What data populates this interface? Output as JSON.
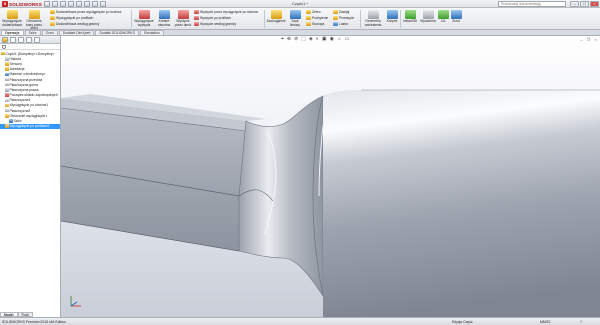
{
  "app": {
    "logo_text": "SOLIDWORKS",
    "window_title": "Część1 *",
    "search_placeholder": "Przeszukaj dokumentację"
  },
  "ribbon": {
    "large_left": [
      {
        "label": "Wyciągnięcie dodania/baza",
        "icon": "extrude-boss-icon",
        "color": "y"
      },
      {
        "label": "Obrócenie bazy przez obrót",
        "icon": "revolve-boss-icon",
        "color": "y"
      }
    ],
    "small_left": [
      "Dodanie/baza przez wyciągnięcie po ścieżce",
      "Wyciągnięcie po profilach",
      "Dodanie/baza według granicy"
    ],
    "large_cut": [
      {
        "label": "Wyciągnięcie wycięcia",
        "icon": "extrude-cut-icon",
        "color": "r"
      },
      {
        "label": "Kreator otworów",
        "icon": "hole-wizard-icon",
        "color": "b"
      },
      {
        "label": "Wycięcie przez obrót",
        "icon": "revolve-cut-icon",
        "color": "r"
      }
    ],
    "small_cut": [
      "Wycięcie przez wyciągnięcie po ścieżce",
      "Wycięcie po profilach",
      "Wycięcie według granicy"
    ],
    "features": [
      {
        "label": "Zaokrąglenie",
        "icon": "fillet-icon",
        "color": "y"
      },
      {
        "label": "Szyk liniowy",
        "icon": "linear-pattern-icon",
        "color": "b"
      }
    ],
    "features_small": [
      "Żebro",
      "Pochylenie",
      "Skorupa",
      "Zawijaj",
      "Przecięcie",
      "Lustro"
    ],
    "geometry": [
      {
        "label": "Geometria odniesienia",
        "icon": "reference-geometry-icon",
        "color": "gr"
      },
      {
        "label": "Krzywe",
        "icon": "curves-icon",
        "color": "b"
      },
      {
        "label": "Instant3D",
        "icon": "instant3d-icon",
        "color": "g"
      }
    ],
    "extras": [
      {
        "label": "Wyrażenia",
        "icon": "equations-icon",
        "color": "gr"
      },
      {
        "label": "CA",
        "icon": "ca-icon",
        "color": "g"
      },
      {
        "label": "Zrzut",
        "icon": "capture-icon",
        "color": "b"
      }
    ]
  },
  "cmd_tabs": [
    "Operacje",
    "Szkic",
    "Oceń",
    "Dodatek DimXpert",
    "Dodatki SOLIDWORKS",
    "Simulation"
  ],
  "tree": {
    "root": "Część1 (Domyślny<<Domyślny>",
    "items": [
      {
        "label": "Historia",
        "icon": "history-icon",
        "indent": 1,
        "color": "gr"
      },
      {
        "label": "Sensory",
        "icon": "sensor-icon",
        "indent": 1,
        "color": "y"
      },
      {
        "label": "Adnotacje",
        "icon": "annotation-icon",
        "indent": 1,
        "color": "y"
      },
      {
        "label": "Materiał <nieokreślony>",
        "icon": "material-icon",
        "indent": 1,
        "color": "b"
      },
      {
        "label": "Płaszczyzna przednia",
        "icon": "plane-icon",
        "indent": 1,
        "color": "gr"
      },
      {
        "label": "Płaszczyzna górna",
        "icon": "plane-icon",
        "indent": 1,
        "color": "gr"
      },
      {
        "label": "Płaszczyzna prawa",
        "icon": "plane-icon",
        "indent": 1,
        "color": "gr"
      },
      {
        "label": "Początek układu współrzędnych",
        "icon": "origin-icon",
        "indent": 1,
        "color": "r"
      },
      {
        "label": "Płaszczyzna1",
        "icon": "plane-icon",
        "indent": 1,
        "color": "gr"
      },
      {
        "label": "Wyciągnięcie po ścieżce1",
        "icon": "sweep-icon",
        "indent": 1,
        "color": "y"
      },
      {
        "label": "Płaszczyzna2",
        "icon": "plane-icon",
        "indent": 1,
        "color": "gr"
      },
      {
        "label": "Obrócenie wyciągnięcie1",
        "icon": "revolve-icon",
        "indent": 1,
        "color": "y"
      },
      {
        "label": "Szkic",
        "icon": "sketch-icon",
        "indent": 2,
        "color": "b"
      },
      {
        "label": "Wyciągnięcie po profilach1",
        "icon": "loft-icon",
        "indent": 1,
        "color": "y",
        "selected": true
      }
    ]
  },
  "model_tabs": [
    "Model",
    "Ruch"
  ],
  "status": {
    "left": "SOLIDWORKS Premium 2015 x64 Edition",
    "middle": "Edycja Część",
    "units": "MMGS",
    "help": "?"
  },
  "viewport": {
    "tools": [
      "⌖",
      "⊕",
      "⊘",
      "⬚",
      "◈",
      "◐",
      "▣",
      "◉",
      "☼",
      "▭"
    ]
  }
}
